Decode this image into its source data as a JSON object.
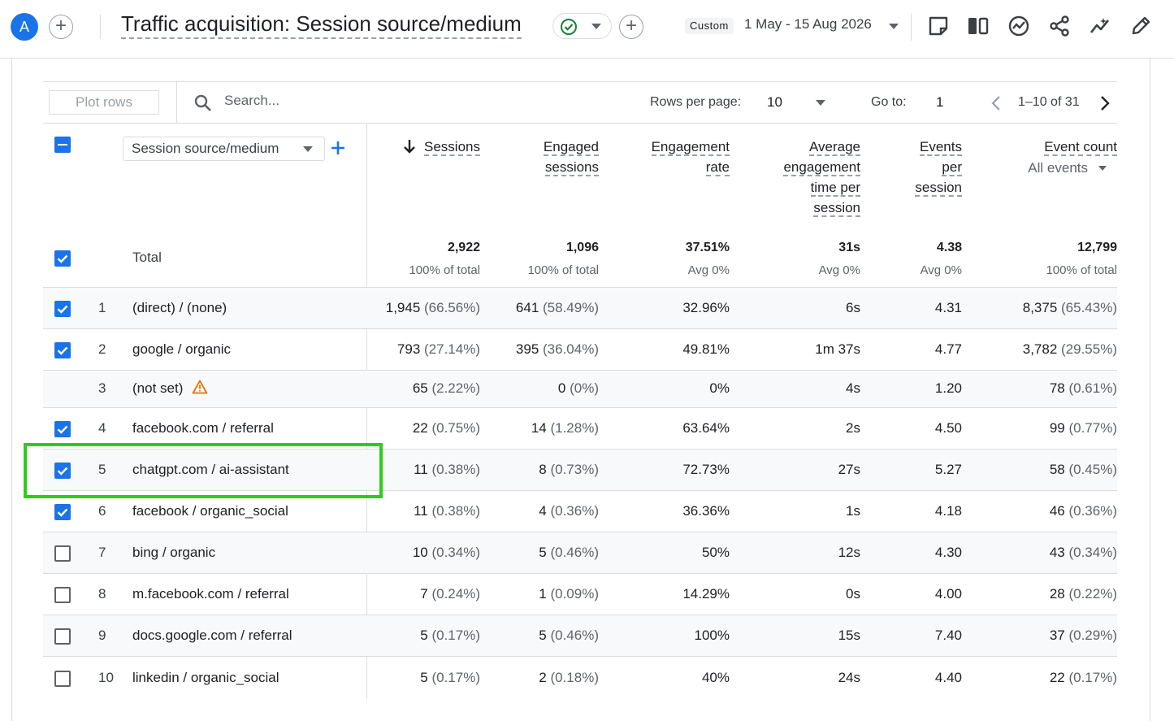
{
  "header": {
    "avatar_letter": "A",
    "title": "Traffic acquisition: Session source/medium",
    "date_chip": "Custom",
    "date_range": "1 May - 15 Aug 2026"
  },
  "toolbar": {
    "plot_rows": "Plot rows",
    "search_placeholder": "Search...",
    "rows_per_page_label": "Rows per page:",
    "rows_per_page_value": "10",
    "goto_label": "Go to:",
    "goto_value": "1",
    "page_range": "1–10 of 31"
  },
  "table": {
    "dimension": "Session source/medium",
    "columns": [
      {
        "lines": [
          "Sessions"
        ]
      },
      {
        "lines": [
          "Engaged",
          "sessions"
        ]
      },
      {
        "lines": [
          "Engagement",
          "rate"
        ]
      },
      {
        "lines": [
          "Average",
          "engagement",
          "time per",
          "session"
        ]
      },
      {
        "lines": [
          "Events",
          "per",
          "session"
        ]
      },
      {
        "lines": [
          "Event count"
        ],
        "sub": "All events"
      }
    ],
    "total": {
      "label": "Total",
      "values": [
        "2,922",
        "1,096",
        "37.51%",
        "31s",
        "4.38",
        "12,799"
      ],
      "subs": [
        "100% of total",
        "100% of total",
        "Avg 0%",
        "Avg 0%",
        "Avg 0%",
        "100% of total"
      ]
    },
    "rows": [
      {
        "n": "1",
        "name": "(direct) / (none)",
        "checked": true,
        "warn": false,
        "sessions": "1,945",
        "sessions_pct": "(66.56%)",
        "engaged": "641",
        "engaged_pct": "(58.49%)",
        "rate": "32.96%",
        "time": "6s",
        "eps": "4.31",
        "events": "8,375",
        "events_pct": "(65.43%)"
      },
      {
        "n": "2",
        "name": "google / organic",
        "checked": true,
        "warn": false,
        "sessions": "793",
        "sessions_pct": "(27.14%)",
        "engaged": "395",
        "engaged_pct": "(36.04%)",
        "rate": "49.81%",
        "time": "1m 37s",
        "eps": "4.77",
        "events": "3,782",
        "events_pct": "(29.55%)"
      },
      {
        "n": "3",
        "name": "(not set)",
        "checked": null,
        "warn": true,
        "sessions": "65",
        "sessions_pct": "(2.22%)",
        "engaged": "0",
        "engaged_pct": "(0%)",
        "rate": "0%",
        "time": "4s",
        "eps": "1.20",
        "events": "78",
        "events_pct": "(0.61%)"
      },
      {
        "n": "4",
        "name": "facebook.com / referral",
        "checked": true,
        "warn": false,
        "sessions": "22",
        "sessions_pct": "(0.75%)",
        "engaged": "14",
        "engaged_pct": "(1.28%)",
        "rate": "63.64%",
        "time": "2s",
        "eps": "4.50",
        "events": "99",
        "events_pct": "(0.77%)"
      },
      {
        "n": "5",
        "name": "chatgpt.com / ai-assistant",
        "checked": true,
        "warn": false,
        "sessions": "11",
        "sessions_pct": "(0.38%)",
        "engaged": "8",
        "engaged_pct": "(0.73%)",
        "rate": "72.73%",
        "time": "27s",
        "eps": "5.27",
        "events": "58",
        "events_pct": "(0.45%)"
      },
      {
        "n": "6",
        "name": "facebook / organic_social",
        "checked": true,
        "warn": false,
        "sessions": "11",
        "sessions_pct": "(0.38%)",
        "engaged": "4",
        "engaged_pct": "(0.36%)",
        "rate": "36.36%",
        "time": "1s",
        "eps": "4.18",
        "events": "46",
        "events_pct": "(0.36%)"
      },
      {
        "n": "7",
        "name": "bing / organic",
        "checked": false,
        "warn": false,
        "sessions": "10",
        "sessions_pct": "(0.34%)",
        "engaged": "5",
        "engaged_pct": "(0.46%)",
        "rate": "50%",
        "time": "12s",
        "eps": "4.30",
        "events": "43",
        "events_pct": "(0.34%)"
      },
      {
        "n": "8",
        "name": "m.facebook.com / referral",
        "checked": false,
        "warn": false,
        "sessions": "7",
        "sessions_pct": "(0.24%)",
        "engaged": "1",
        "engaged_pct": "(0.09%)",
        "rate": "14.29%",
        "time": "0s",
        "eps": "4.00",
        "events": "28",
        "events_pct": "(0.22%)"
      },
      {
        "n": "9",
        "name": "docs.google.com / referral",
        "checked": false,
        "warn": false,
        "sessions": "5",
        "sessions_pct": "(0.17%)",
        "engaged": "5",
        "engaged_pct": "(0.46%)",
        "rate": "100%",
        "time": "15s",
        "eps": "7.40",
        "events": "37",
        "events_pct": "(0.29%)"
      },
      {
        "n": "10",
        "name": "linkedin / organic_social",
        "checked": false,
        "warn": false,
        "sessions": "5",
        "sessions_pct": "(0.17%)",
        "engaged": "2",
        "engaged_pct": "(0.18%)",
        "rate": "40%",
        "time": "24s",
        "eps": "4.40",
        "events": "22",
        "events_pct": "(0.17%)"
      }
    ]
  },
  "colors": {
    "accent": "#1a73e8",
    "highlight": "#2ecc1a",
    "status_ok": "#188038",
    "warning": "#e37400"
  },
  "icons": [
    "plus-icon",
    "check-circle-icon",
    "chevron-down-icon",
    "share-report-icon",
    "compare-icon",
    "insights-icon",
    "share-icon",
    "trend-icon",
    "edit-icon",
    "search-icon",
    "arrow-down-icon",
    "chevron-left-icon",
    "chevron-right-icon",
    "warning-icon"
  ]
}
